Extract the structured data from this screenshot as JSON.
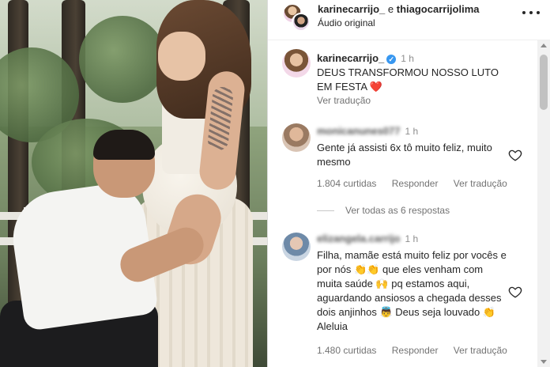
{
  "header": {
    "user1": "karinecarrijo_",
    "connector": " e ",
    "user2": "thiagocarrijolima",
    "audio": "Áudio original"
  },
  "comments": [
    {
      "username": "karinecarrijo_",
      "verified": true,
      "time": "1 h",
      "text": "DEUS TRANSFORMOU NOSSO LUTO EM FESTA ❤️",
      "translate": "Ver tradução"
    },
    {
      "username": "monicanunes077",
      "time": "1 h",
      "text": "Gente já assisti 6x tô muito feliz, muito mesmo",
      "likes": "1.804 curtidas",
      "reply": "Responder",
      "translate": "Ver tradução"
    },
    {
      "username": "elizangela.carrijo",
      "time": "1 h",
      "text": "Filha, mamãe está muito feliz por vocês e por nós 👏👏 que eles venham com muita saúde 🙌 pq estamos aqui, aguardando ansiosos a chegada desses dois anjinhos 👼 Deus seja louvado 👏 Aleluia",
      "likes": "1.480 curtidas",
      "reply": "Responder",
      "translate": "Ver tradução"
    }
  ],
  "view_replies": "Ver todas as 6 respostas",
  "icons": {
    "more": "more-options-icon",
    "heart": "heart-outline-icon",
    "verified": "verified-badge-icon"
  },
  "colors": {
    "verified": "#3897f0",
    "heart": "#e0245e",
    "muted": "#737373"
  }
}
